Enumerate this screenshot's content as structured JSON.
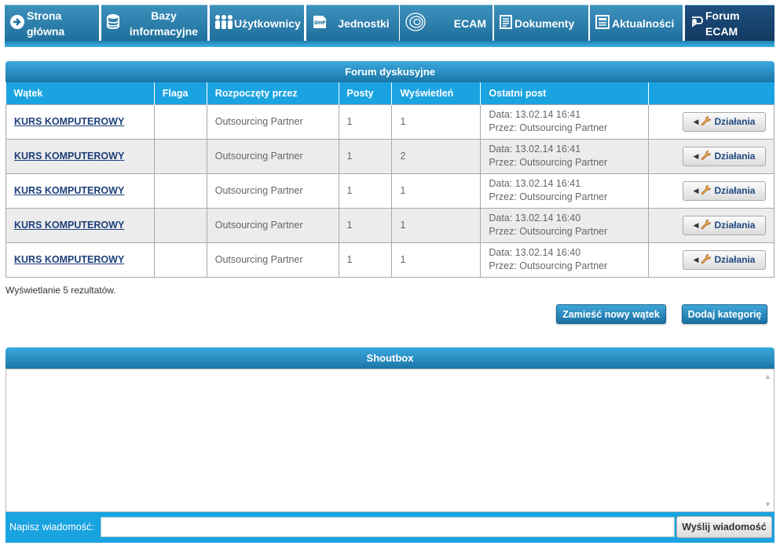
{
  "nav": {
    "tabs": [
      {
        "label_line1": "Strona główna",
        "label_line2": ""
      },
      {
        "label_line1": "Bazy",
        "label_line2": "informacyjne"
      },
      {
        "label_line1": "Użytkownicy",
        "label_line2": ""
      },
      {
        "label_line1": "Jednostki",
        "label_line2": ""
      },
      {
        "label_line1": "ECAM",
        "label_line2": ""
      },
      {
        "label_line1": "Dokumenty",
        "label_line2": ""
      },
      {
        "label_line1": "Aktualności",
        "label_line2": ""
      },
      {
        "label_line1": "Forum ECAM",
        "label_line2": ""
      }
    ],
    "icons": {
      "dhp_text": "DHP"
    }
  },
  "forum": {
    "title": "Forum dyskusyjne",
    "columns": [
      "Wątek",
      "Flaga",
      "Rozpoczęty przez",
      "Posty",
      "Wyświetleń",
      "Ostatni post",
      ""
    ],
    "rows": [
      {
        "thread": "KURS KOMPUTEROWY",
        "flag": "",
        "started_by": "Outsourcing Partner",
        "posts": "1",
        "views": "1",
        "last_date": "Data: 13.02.14 16:41",
        "last_by": "Przez: Outsourcing Partner",
        "action": "Działania"
      },
      {
        "thread": "KURS KOMPUTEROWY",
        "flag": "",
        "started_by": "Outsourcing Partner",
        "posts": "1",
        "views": "2",
        "last_date": "Data: 13.02.14 16:41",
        "last_by": "Przez: Outsourcing Partner",
        "action": "Działania"
      },
      {
        "thread": "KURS KOMPUTEROWY",
        "flag": "",
        "started_by": "Outsourcing Partner",
        "posts": "1",
        "views": "1",
        "last_date": "Data: 13.02.14 16:41",
        "last_by": "Przez: Outsourcing Partner",
        "action": "Działania"
      },
      {
        "thread": "KURS KOMPUTEROWY",
        "flag": "",
        "started_by": "Outsourcing Partner",
        "posts": "1",
        "views": "1",
        "last_date": "Data: 13.02.14 16:40",
        "last_by": "Przez: Outsourcing Partner",
        "action": "Działania"
      },
      {
        "thread": "KURS KOMPUTEROWY",
        "flag": "",
        "started_by": "Outsourcing Partner",
        "posts": "1",
        "views": "1",
        "last_date": "Data: 13.02.14 16:40",
        "last_by": "Przez: Outsourcing Partner",
        "action": "Działania"
      }
    ],
    "result_text": "Wyświetlanie 5 rezultatów.",
    "new_thread_label": "Zamieść nowy wątek",
    "add_category_label": "Dodaj kategorię"
  },
  "shoutbox": {
    "title": "Shoutbox",
    "message_label": "Napisz wiadomość:",
    "message_value": "",
    "send_label": "Wyślij wiadomość"
  },
  "colors": {
    "nav_tab": "#2a7fae",
    "nav_active": "#173f6a",
    "header_blue": "#1aa3e1",
    "link": "#1d3f7a"
  }
}
